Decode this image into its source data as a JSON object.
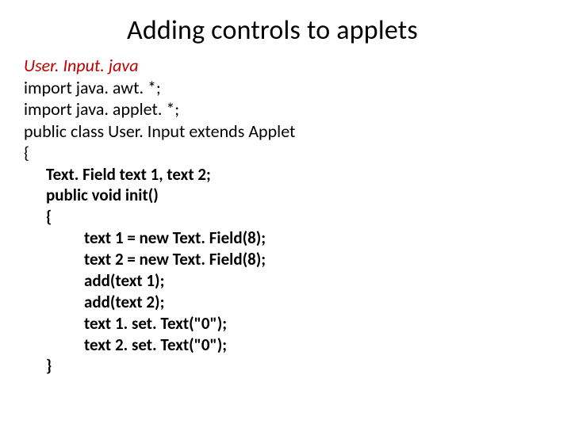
{
  "title": "Adding controls to applets",
  "filename": "User. Input. java",
  "code": {
    "l1": "import java. awt. *;",
    "l2": "import java. applet. *;",
    "l3": "public class User. Input extends Applet",
    "l4": "{",
    "l5": "Text. Field  text 1, text 2;",
    "l6": "public void init()",
    "l7": "{",
    "l8": "text 1 = new Text. Field(8);",
    "l9": "text 2 = new Text. Field(8);",
    "l10": "add(text 1);",
    "l11": "add(text 2);",
    "l12": "text 1. set. Text(\"0\");",
    "l13": "text 2. set. Text(\"0\");",
    "l14": "}"
  }
}
